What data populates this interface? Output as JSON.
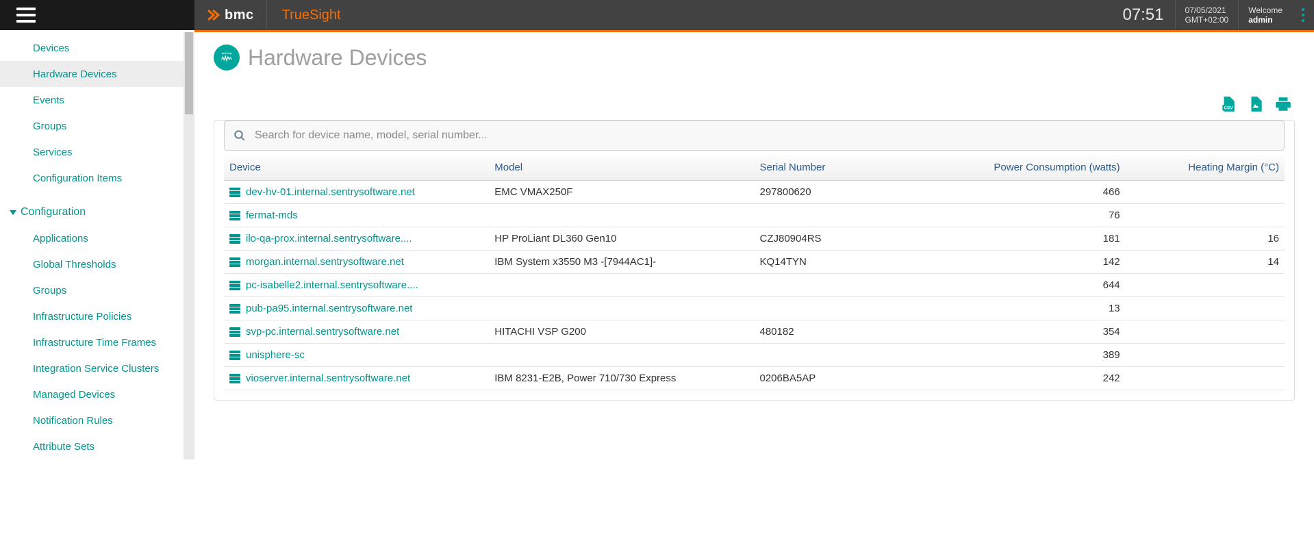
{
  "brand": {
    "logo_text": "bmc",
    "product": "TrueSight"
  },
  "header": {
    "time": "07:51",
    "date": "07/05/2021",
    "tz": "GMT+02:00",
    "welcome_label": "Welcome",
    "user": "admin"
  },
  "sidebar": {
    "monitoring_items": [
      {
        "label": "Devices"
      },
      {
        "label": "Hardware Devices",
        "active": true
      },
      {
        "label": "Events"
      },
      {
        "label": "Groups"
      },
      {
        "label": "Services"
      },
      {
        "label": "Configuration Items"
      }
    ],
    "config_header": "Configuration",
    "config_items": [
      {
        "label": "Applications"
      },
      {
        "label": "Global Thresholds"
      },
      {
        "label": "Groups"
      },
      {
        "label": "Infrastructure Policies"
      },
      {
        "label": "Infrastructure Time Frames"
      },
      {
        "label": "Integration Service Clusters"
      },
      {
        "label": "Managed Devices"
      },
      {
        "label": "Notification Rules"
      },
      {
        "label": "Attribute Sets"
      }
    ]
  },
  "page": {
    "title": "Hardware Devices"
  },
  "search": {
    "placeholder": "Search for device name, model, serial number..."
  },
  "table": {
    "columns": {
      "device": "Device",
      "model": "Model",
      "serial": "Serial Number",
      "power": "Power Consumption (watts)",
      "heat": "Heating Margin (°C)"
    },
    "rows": [
      {
        "device": "dev-hv-01.internal.sentrysoftware.net",
        "model": "EMC VMAX250F",
        "serial": "297800620",
        "power": "466",
        "heat": ""
      },
      {
        "device": "fermat-mds",
        "model": "",
        "serial": "",
        "power": "76",
        "heat": ""
      },
      {
        "device": "ilo-qa-prox.internal.sentrysoftware....",
        "model": "HP ProLiant DL360 Gen10",
        "serial": "CZJ80904RS",
        "power": "181",
        "heat": "16"
      },
      {
        "device": "morgan.internal.sentrysoftware.net",
        "model": "IBM System x3550 M3 -[7944AC1]-",
        "serial": "KQ14TYN",
        "power": "142",
        "heat": "14"
      },
      {
        "device": "pc-isabelle2.internal.sentrysoftware....",
        "model": "",
        "serial": "",
        "power": "644",
        "heat": ""
      },
      {
        "device": "pub-pa95.internal.sentrysoftware.net",
        "model": "",
        "serial": "",
        "power": "13",
        "heat": ""
      },
      {
        "device": "svp-pc.internal.sentrysoftware.net",
        "model": "HITACHI VSP G200",
        "serial": "480182",
        "power": "354",
        "heat": ""
      },
      {
        "device": "unisphere-sc",
        "model": "",
        "serial": "",
        "power": "389",
        "heat": ""
      },
      {
        "device": "vioserver.internal.sentrysoftware.net",
        "model": "IBM 8231-E2B, Power 710/730 Express",
        "serial": "0206BA5AP",
        "power": "242",
        "heat": ""
      }
    ]
  },
  "colors": {
    "accent": "#00a79d",
    "brand_orange": "#f86e00"
  }
}
